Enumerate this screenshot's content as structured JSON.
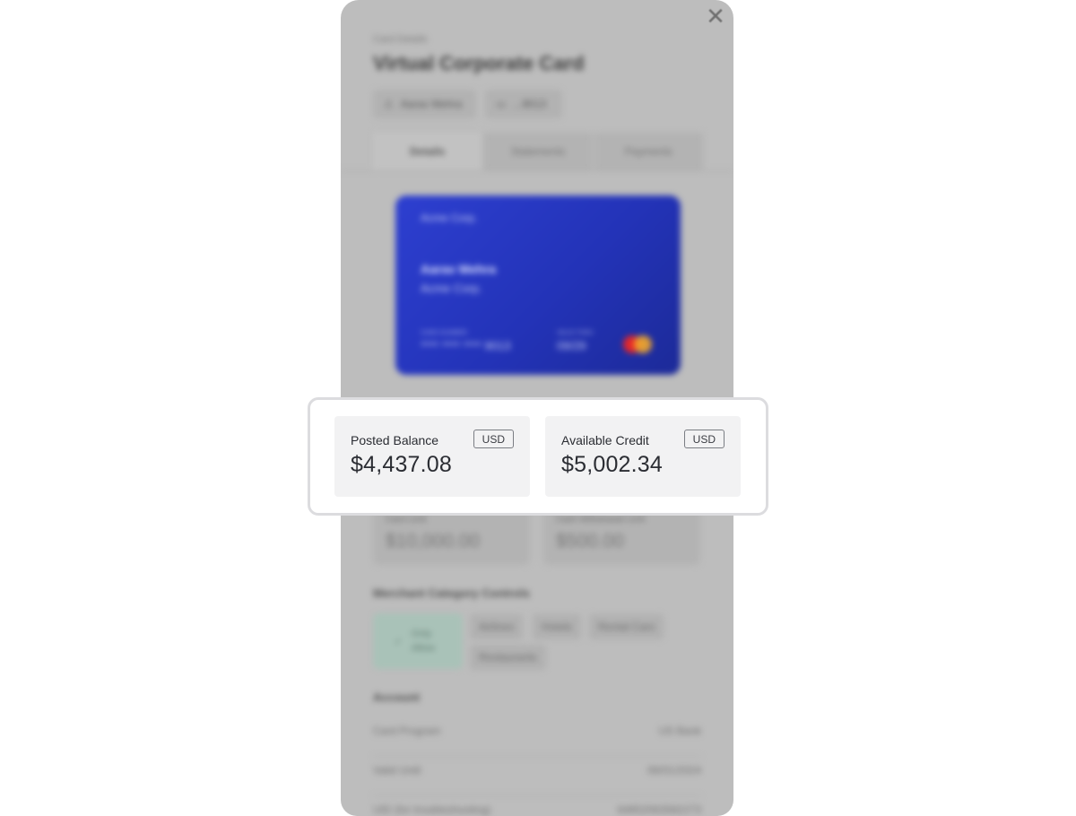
{
  "panel": {
    "eyebrow": "Card Details",
    "title": "Virtual Corporate Card",
    "owner_chip": "Aarav Mehra",
    "last4_chip": "...9013",
    "tabs": [
      "Details",
      "Statements",
      "Payments"
    ],
    "active_tab": "Details"
  },
  "card": {
    "company_top": "Acme Corp.",
    "holder": "Aarav Mehra",
    "company": "Acme Corp.",
    "number_label": "CARD NUMBER",
    "number": "**** **** **** 9013",
    "expiry_label": "VALID THRU",
    "expiry": "09/29",
    "brand_icon": "mastercard-logo"
  },
  "balances": {
    "posted": {
      "label": "Posted Balance",
      "currency": "USD",
      "amount": "$4,437.08"
    },
    "available": {
      "label": "Available Credit",
      "currency": "USD",
      "amount": "$5,002.34"
    }
  },
  "limits": {
    "card_limit": {
      "label": "Card Limit",
      "amount": "$10,000.00"
    },
    "cash_limit": {
      "label": "Cash Withdrawal Limit",
      "amount": "$500.00"
    }
  },
  "merchant_controls": {
    "heading": "Merchant Category Controls",
    "mode": "Only Allow",
    "categories": [
      "Airlines",
      "Hotels",
      "Rental Cars",
      "Restaurants"
    ]
  },
  "account": {
    "heading": "Account",
    "rows": [
      {
        "key": "Card Program",
        "value": "US Bank"
      },
      {
        "key": "Valid Until",
        "value": "06/01/2024"
      },
      {
        "key": "UID (for troubleshooting)",
        "value": "64852063582273"
      }
    ]
  },
  "colors": {
    "card_gradient_start": "#2d3fd0",
    "card_gradient_end": "#1c2a98",
    "highlight_border": "#dcdcdf",
    "stat_bg": "#f2f2f3"
  }
}
